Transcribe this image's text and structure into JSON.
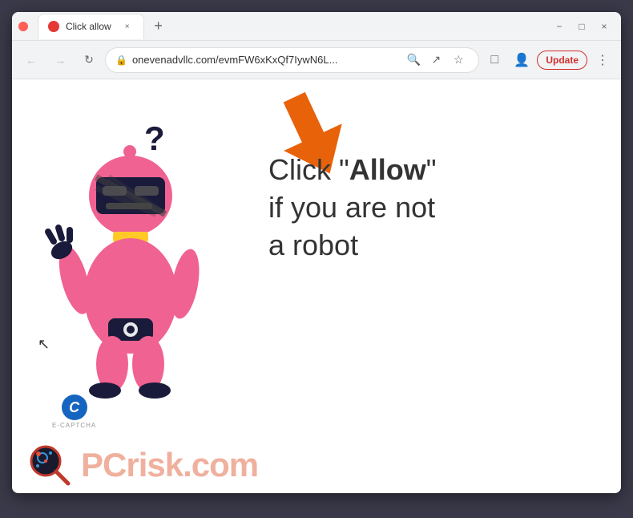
{
  "window": {
    "title": "Click allow",
    "tab_close_label": "×",
    "new_tab_label": "+"
  },
  "window_controls": {
    "minimize": "−",
    "maximize": "□",
    "close": "×"
  },
  "nav": {
    "back_label": "←",
    "forward_label": "→",
    "reload_label": "↻",
    "url": "onevenadvllc.com/evmFW6xKxQf7IywN6L...",
    "search_label": "🔍",
    "share_label": "↗",
    "bookmark_label": "☆",
    "extensions_label": "□",
    "profile_label": "👤",
    "update_label": "Update",
    "more_label": "⋮"
  },
  "page": {
    "captcha_line1": "Click \"",
    "captcha_bold": "Allow",
    "captcha_line1_end": "\"",
    "captcha_line2": "if you are not",
    "captcha_line3": "a robot",
    "question_mark": "?",
    "ecaptcha_label": "E-CAPTCHA",
    "ecaptcha_letter": "C"
  },
  "watermark": {
    "text": "PC",
    "text_colored": "risk",
    "suffix": ".com"
  },
  "colors": {
    "accent_orange": "#e8620a",
    "robot_pink": "#f06292",
    "robot_dark": "#1a1a3a",
    "update_red": "#d32f2f",
    "text_dark": "#2c2c3a"
  }
}
